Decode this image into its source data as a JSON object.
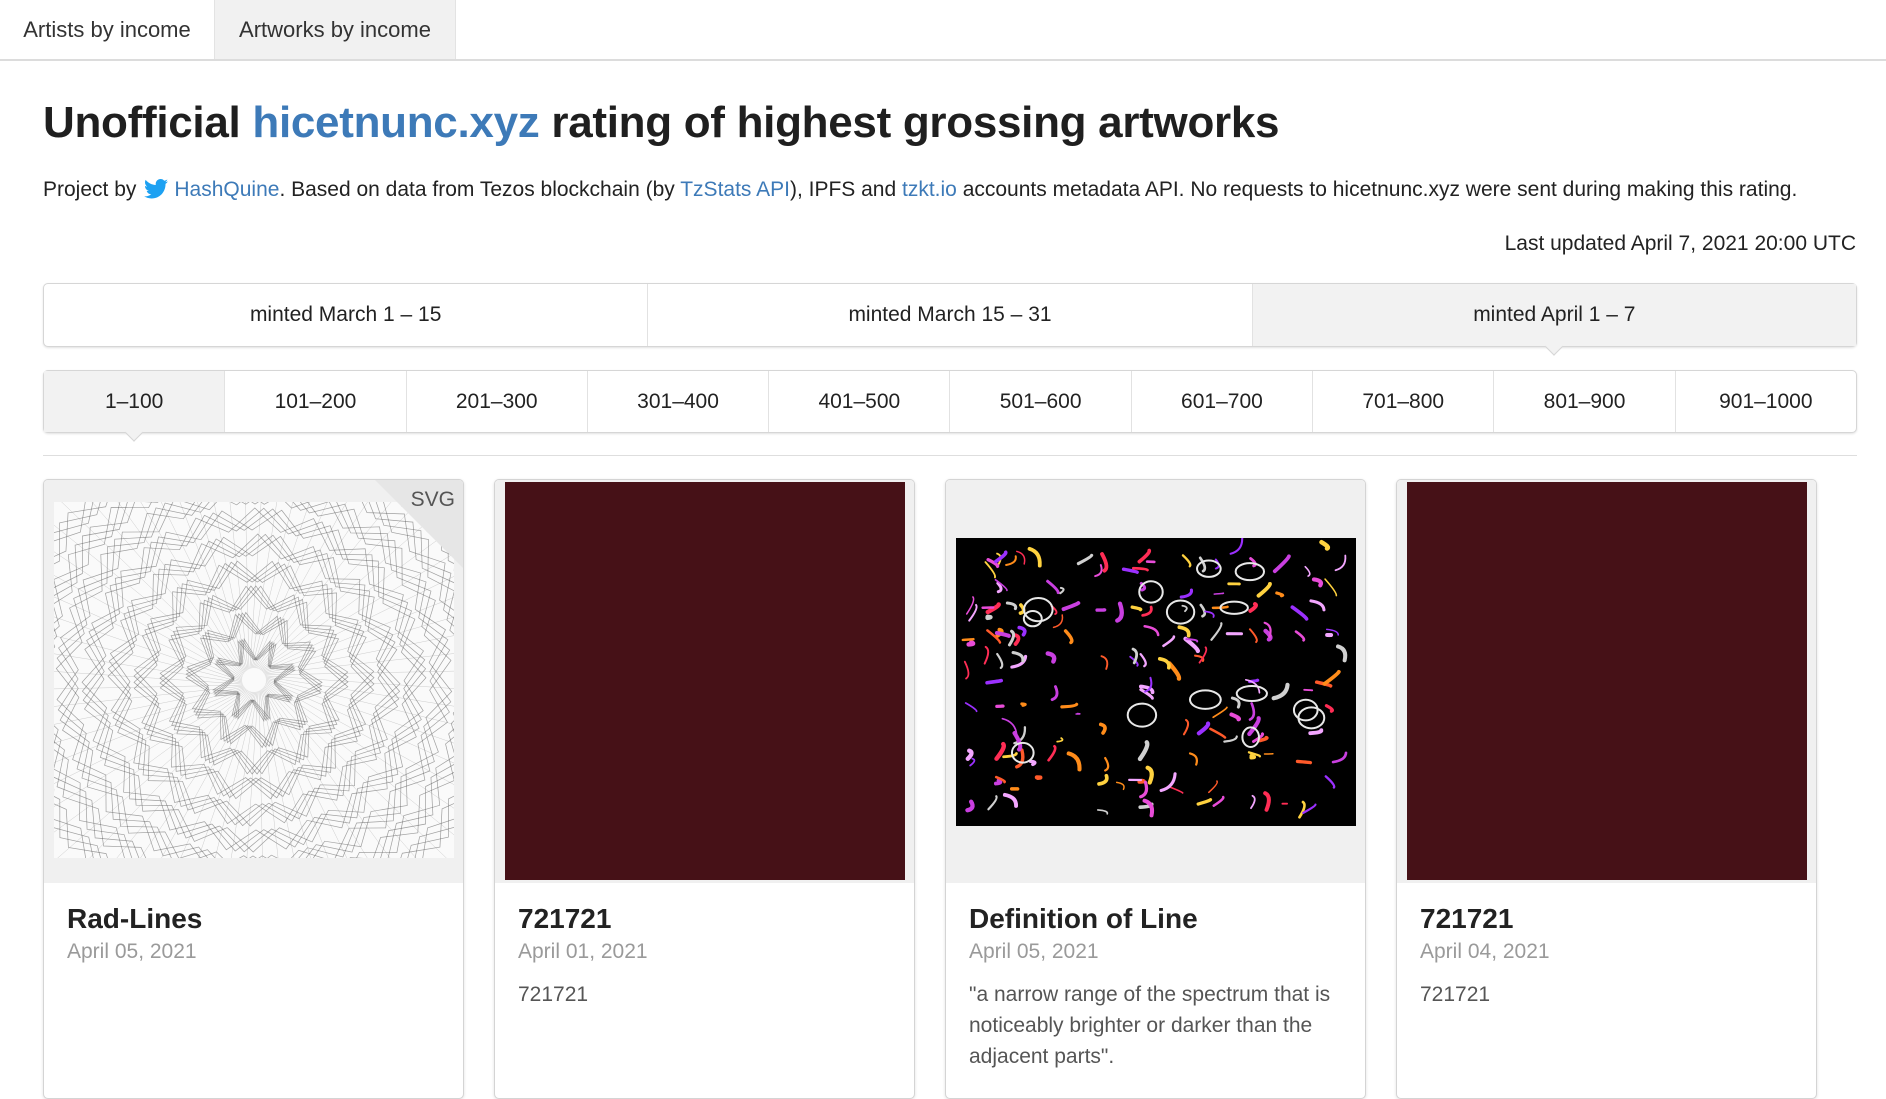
{
  "nav": {
    "tabs": [
      {
        "label": "Artists by income"
      },
      {
        "label": "Artworks by income"
      }
    ]
  },
  "header": {
    "title_before": "Unofficial ",
    "title_link": "hicetnunc.xyz",
    "title_after": " rating of highest grossing artworks",
    "subtitle": {
      "project_by": "Project by",
      "author": "HashQuine",
      "part2": ". Based on data from Tezos blockchain (by ",
      "tzstats": "TzStats API",
      "part3": "), IPFS and ",
      "tzkt": "tzkt.io",
      "part4": " accounts metadata API. No requests to hicetnunc.xyz were sent during making this rating."
    },
    "last_updated": "Last updated April 7, 2021 20:00 UTC"
  },
  "date_filters": [
    "minted March 1 – 15",
    "minted March 15 – 31",
    "minted April 1 – 7"
  ],
  "active_date_filter": "minted April 1 – 7",
  "rank_ranges": [
    "1–100",
    "101–200",
    "201–300",
    "301–400",
    "401–500",
    "501–600",
    "601–700",
    "701–800",
    "801–900",
    "901–1000"
  ],
  "active_rank_range": "1–100",
  "cards": [
    {
      "name": "Rad-Lines",
      "date": "April 05, 2021",
      "description": "",
      "badge": "SVG",
      "image": "radial-lines-artwork"
    },
    {
      "name": "721721",
      "date": "April 01, 2021",
      "description": "721721",
      "badge": "",
      "image": "maroon-square"
    },
    {
      "name": "Definition of Line",
      "date": "April 05, 2021",
      "description": "\"a narrow range of the spectrum that is noticeably brighter or darker than the adjacent parts\".",
      "badge": "",
      "image": "colorful-line-strokes-artwork"
    },
    {
      "name": "721721",
      "date": "April 04, 2021",
      "description": "721721",
      "badge": "",
      "image": "maroon-square"
    }
  ],
  "colors": {
    "link": "#3d7ab8",
    "maroon": "#461117",
    "active_bg": "#f2f2f2",
    "twitter": "#1da1f2"
  }
}
